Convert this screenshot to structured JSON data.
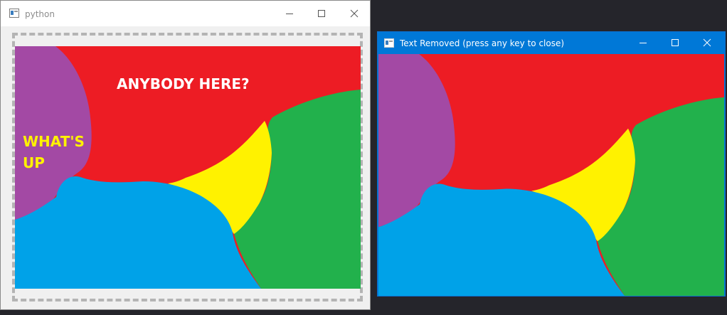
{
  "window_source": {
    "title": "python",
    "controls": {
      "minimize_icon": "minimize-icon",
      "maximize_icon": "maximize-icon",
      "close_icon": "close-icon"
    },
    "overlay_texts": {
      "top": "ANYBODY HERE?",
      "left": "WHAT'S\nUP"
    }
  },
  "window_result": {
    "title": "Text Removed (press any key to close)",
    "controls": {
      "minimize_icon": "minimize-icon",
      "maximize_icon": "maximize-icon",
      "close_icon": "close-icon"
    }
  },
  "colors": {
    "purple": "#a349a4",
    "red": "#ed1c24",
    "green": "#22b14c",
    "yellow": "#fff200",
    "blue": "#00a2e8",
    "text_yellow": "#fff200",
    "text_white": "#ffffff",
    "active_titlebar": "#0078d7",
    "desktop": "#25252b"
  }
}
